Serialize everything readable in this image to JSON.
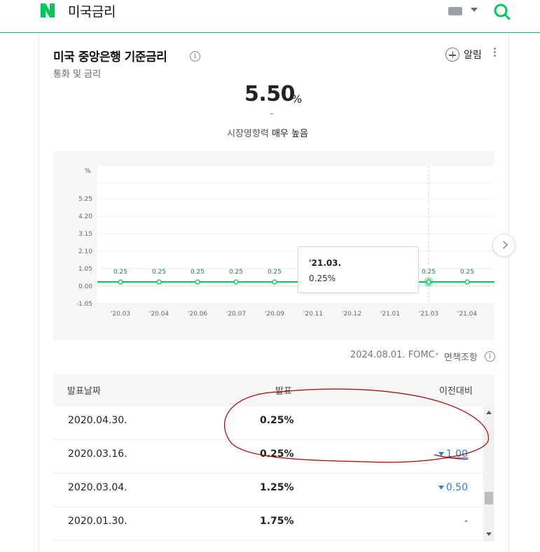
{
  "header": {
    "logo_letter": "N",
    "query": "미국금리",
    "colors": {
      "brand": "#03c75a"
    }
  },
  "card": {
    "title": "미국 중앙은행 기준금리",
    "subtitle": "통화 및 금리",
    "alarm_label": "알림",
    "rate_value": "5.50",
    "rate_unit": "%",
    "rate_change": "-",
    "impact_prefix": "시장영향력",
    "impact_level": "매우 높음"
  },
  "chart_data": {
    "type": "line",
    "unit_label": "%",
    "y_ticks": [
      "5.25",
      "4.20",
      "3.15",
      "2.10",
      "1.05",
      "0.00",
      "-1.05"
    ],
    "ylim": [
      -1.05,
      5.25
    ],
    "categories": [
      "'20.03",
      "'20.04",
      "'20.06",
      "'20.07",
      "'20.09",
      "'20.11",
      "'20.12",
      "'21.01",
      "'21.03",
      "'21.04"
    ],
    "values": [
      0.25,
      0.25,
      0.25,
      0.25,
      0.25,
      0.25,
      0.25,
      0.25,
      0.25,
      0.25
    ],
    "data_labels": [
      "0.25",
      "0.25",
      "0.25",
      "0.25",
      "0.25",
      "0.25",
      "0.25",
      "0.25",
      "0.25",
      "0.25"
    ],
    "highlight_index": 8,
    "grid": true,
    "line_color": "#03c75a",
    "tooltip": {
      "date": "'21.03.",
      "value": "0.25%"
    }
  },
  "footer": {
    "source": "2024.08.01. FOMC",
    "separator": "•",
    "disclaimer": "면책조항"
  },
  "table": {
    "headers": {
      "date": "발표날짜",
      "value": "발표",
      "diff": "이전대비"
    },
    "rows": [
      {
        "date": "2020.04.30.",
        "value": "0.25%",
        "diff": ""
      },
      {
        "date": "2020.03.16.",
        "value": "0.25%",
        "diff": "1.00",
        "dir": "down"
      },
      {
        "date": "2020.03.04.",
        "value": "1.25%",
        "diff": "0.50",
        "dir": "down"
      },
      {
        "date": "2020.01.30.",
        "value": "1.75%",
        "diff": "-"
      }
    ]
  },
  "colors": {
    "down": "#2c7be5",
    "annotation": "#b00000"
  }
}
